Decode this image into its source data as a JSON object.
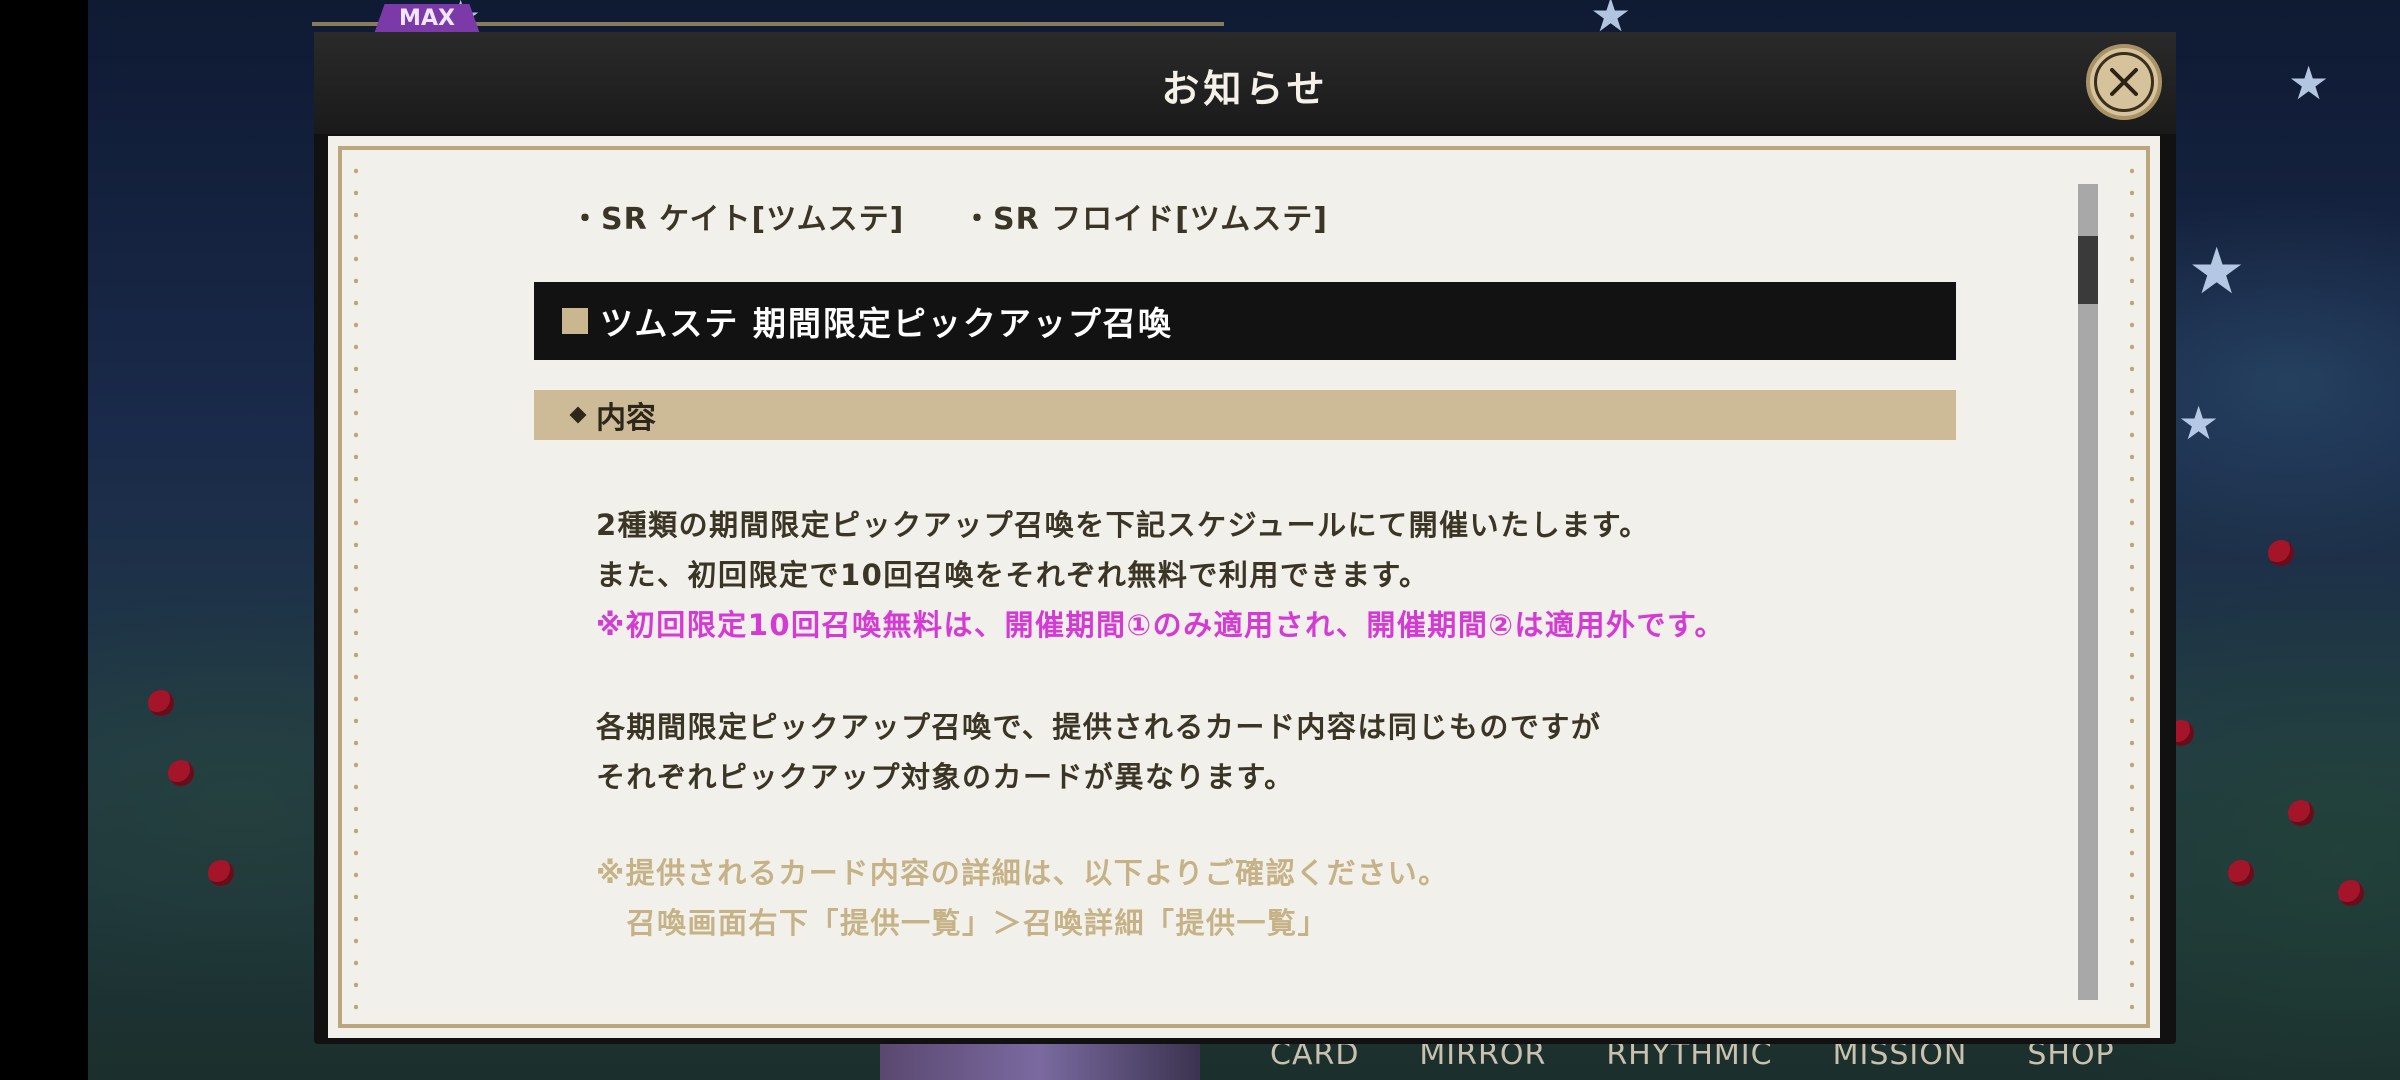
{
  "header": {
    "max_badge": "MAX",
    "title": "お知らせ",
    "close_icon": "close-x"
  },
  "content": {
    "sr_items": [
      "・SR ケイト[ツムステ]",
      "・SR フロイド[ツムステ]"
    ],
    "section_heading": "ツムステ 期間限定ピックアップ召喚",
    "subsection_heading": "内容",
    "paragraph_lines": [
      "2種類の期間限定ピックアップ召喚を下記スケジュールにて開催いたします。",
      "また、初回限定で10回召喚をそれぞれ無料で利用できます。"
    ],
    "highlight_note": "※初回限定10回召喚無料は、開催期間①のみ適用され、開催期間②は適用外です。",
    "paragraph2_lines": [
      "各期間限定ピックアップ召喚で、提供されるカード内容は同じものですが",
      "それぞれピックアップ対象のカードが異なります。"
    ],
    "detail_note_lines": [
      "※提供されるカード内容の詳細は、以下よりご確認ください。",
      "　召喚画面右下「提供一覧」＞召喚詳細「提供一覧」"
    ]
  },
  "bottom_nav": [
    "CARD",
    "MIRROR",
    "RHYTHMIC",
    "MISSION",
    "SHOP"
  ],
  "colors": {
    "highlight": "#d63ad6",
    "gold_accent": "#c9b88f",
    "heading_bg": "#121212"
  }
}
